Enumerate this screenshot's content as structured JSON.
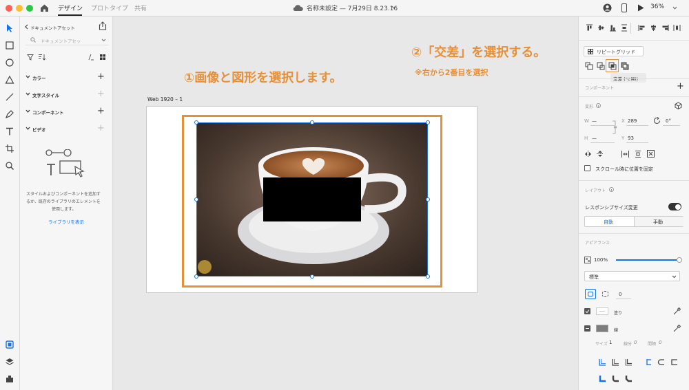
{
  "titlebar": {
    "tabs": [
      "デザイン",
      "プロトタイプ",
      "共有"
    ],
    "document_title": "名称未設定 — 7月29日 8.23.16",
    "zoom": "36%"
  },
  "assets": {
    "back_label": "ドキュメントアセット",
    "search_placeholder": "ドキュメントアセッ",
    "sections": [
      "カラー",
      "文字スタイル",
      "コンポーネント",
      "ビデオ"
    ],
    "empty_text_1": "スタイルおよびコンポーネントを追加す",
    "empty_text_2": "るか、既存のライブラリのエレメントを",
    "empty_text_3": "使用します。",
    "library_link": "ライブラリを表示"
  },
  "canvas": {
    "artboard_label": "Web 1920 – 1",
    "annotation_1": "①画像と図形を選択します。",
    "annotation_2": "②「交差」を選択する。",
    "annotation_3": "※右から2番目を選択"
  },
  "props": {
    "repeat_grid": "リピートグリッド",
    "tooltip": "交差 (⌥⌘I)",
    "component_label": "コンポーネント",
    "transform_label": "変形",
    "w_label": "W",
    "w_value": "—",
    "x_label": "X",
    "x_value": "289",
    "h_label": "H",
    "h_value": "—",
    "y_label": "Y",
    "y_value": "93",
    "rotation": "0°",
    "fix_scroll": "スクロール時に位置を固定",
    "layout_label": "レイアウト",
    "responsive": "レスポンシブサイズ変更",
    "auto": "自動",
    "manual": "手動",
    "appearance": "アピアランス",
    "opacity": "100%",
    "opacity_value": 1.0,
    "blend": "標準",
    "radius": "0",
    "fill": "塗り",
    "stroke": "線",
    "size_label": "サイズ",
    "size_value": "1",
    "dash_label": "線分",
    "dash_value": "0",
    "gap_label": "間隔",
    "gap_value": "0"
  },
  "colors": {
    "orange": "#e6913a",
    "blue": "#1473e6"
  }
}
